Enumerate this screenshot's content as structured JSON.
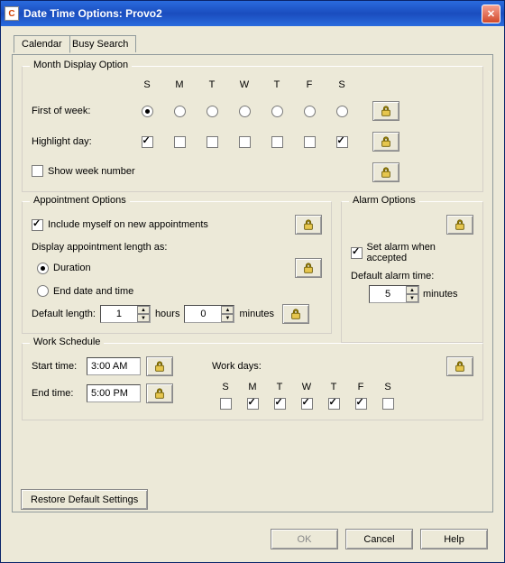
{
  "window": {
    "title": "Date Time Options:  Provo2"
  },
  "tabs": {
    "calendar": "Calendar",
    "busySearch": "Busy Search"
  },
  "monthDisplay": {
    "title": "Month Display Option",
    "days": [
      "S",
      "M",
      "T",
      "W",
      "T",
      "F",
      "S"
    ],
    "firstOfWeekLabel": "First of week:",
    "highlightDayLabel": "Highlight day:",
    "firstOfWeekSelected": 0,
    "highlightChecked": [
      true,
      false,
      false,
      false,
      false,
      false,
      true
    ],
    "showWeekNumber": "Show week number"
  },
  "appointment": {
    "title": "Appointment Options",
    "includeMyself": "Include myself on new appointments",
    "displayLengthAs": "Display appointment length as:",
    "duration": "Duration",
    "endDateTime": "End date and time",
    "defaultLength": "Default length:",
    "hoursLabel": "hours",
    "minutesLabel": "minutes",
    "hoursValue": "1",
    "minutesValue": "0"
  },
  "alarm": {
    "title": "Alarm Options",
    "setAlarm": "Set alarm when accepted",
    "defaultAlarmTime": "Default alarm time:",
    "value": "5",
    "unit": "minutes"
  },
  "workSchedule": {
    "title": "Work Schedule",
    "startLabel": "Start time:",
    "endLabel": "End time:",
    "start": "3:00 AM",
    "end": "5:00 PM",
    "workDaysLabel": "Work days:",
    "days": [
      "S",
      "M",
      "T",
      "W",
      "T",
      "F",
      "S"
    ],
    "checked": [
      false,
      true,
      true,
      true,
      true,
      true,
      false
    ]
  },
  "buttons": {
    "restore": "Restore Default Settings",
    "ok": "OK",
    "cancel": "Cancel",
    "help": "Help"
  },
  "icons": {
    "lock": "lock"
  }
}
